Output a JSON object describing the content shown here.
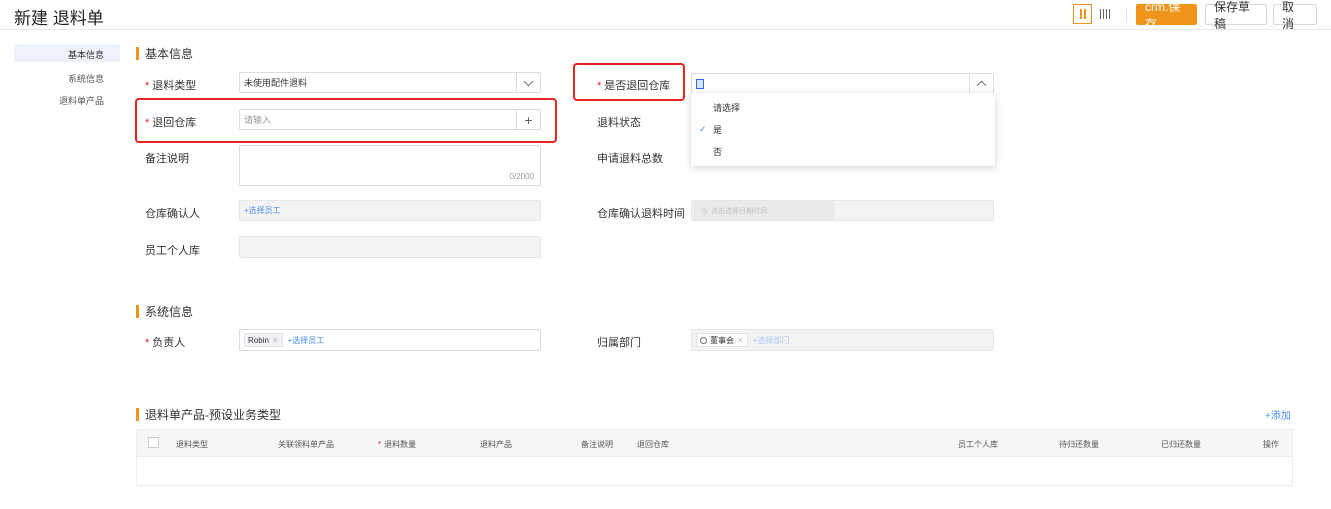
{
  "header": {
    "title": "新建 退料单",
    "save_label": "crm.保存",
    "draft_label": "保存草稿",
    "cancel_label": "取 消"
  },
  "nav": {
    "items": [
      "基本信息",
      "系统信息",
      "退料单产品"
    ],
    "active_index": 0
  },
  "basic": {
    "section_title": "基本信息",
    "return_type": {
      "label": "退料类型",
      "value": "未使用配件退料"
    },
    "return_warehouse": {
      "label": "退回仓库",
      "placeholder": "请输入"
    },
    "remark": {
      "label": "备注说明",
      "counter": "0/2000"
    },
    "wh_confirmer": {
      "label": "仓库确认人",
      "action": "+选择员工"
    },
    "personal_wh": {
      "label": "员工个人库"
    },
    "is_return_wh": {
      "label": "是否退回仓库"
    },
    "return_status": {
      "label": "退料状态"
    },
    "apply_total": {
      "label": "申请退料总数"
    },
    "wh_confirm_time": {
      "label": "仓库确认退料时间",
      "placeholder": "点击选择日期时间"
    }
  },
  "dropdown": {
    "options": [
      "请选择",
      "是",
      "否"
    ],
    "selected": "是"
  },
  "system": {
    "section_title": "系统信息",
    "owner": {
      "label": "负责人",
      "tag": "Robin",
      "action": "+选择员工"
    },
    "dept": {
      "label": "归属部门",
      "tag": "董事会",
      "action": "+选择部门"
    }
  },
  "products": {
    "section_title": "退料单产品-预设业务类型",
    "add_label": "+添加",
    "columns": [
      "退料类型",
      "关联领料单产品",
      "退料数量",
      "退料产品",
      "备注说明",
      "退回仓库",
      "员工个人库",
      "待归还数量",
      "已归还数量",
      "操作"
    ]
  },
  "colors": {
    "accent": "#f0941c",
    "required": "#e0241f",
    "highlight": "#e62222",
    "link": "#4d8ef0"
  }
}
